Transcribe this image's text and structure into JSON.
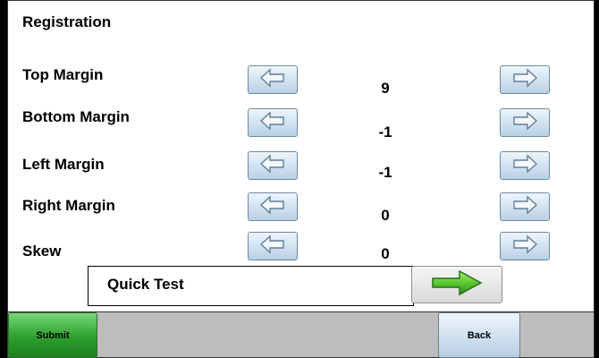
{
  "title": "Registration",
  "rows": [
    {
      "label": "Top Margin",
      "value": "9"
    },
    {
      "label": "Bottom Margin",
      "value": "-1"
    },
    {
      "label": "Left Margin",
      "value": "-1"
    },
    {
      "label": "Right Margin",
      "value": "0"
    },
    {
      "label": "Skew",
      "value": "0"
    }
  ],
  "quick_test": {
    "label": "Quick Test",
    "icon": "green-right-arrow-icon"
  },
  "footer": {
    "submit_label": "Submit",
    "back_label": "Back"
  },
  "colors": {
    "accent_green": "#2ca02c",
    "button_blue": "#d2e3f1",
    "footer_gray": "#bdbdbd"
  }
}
